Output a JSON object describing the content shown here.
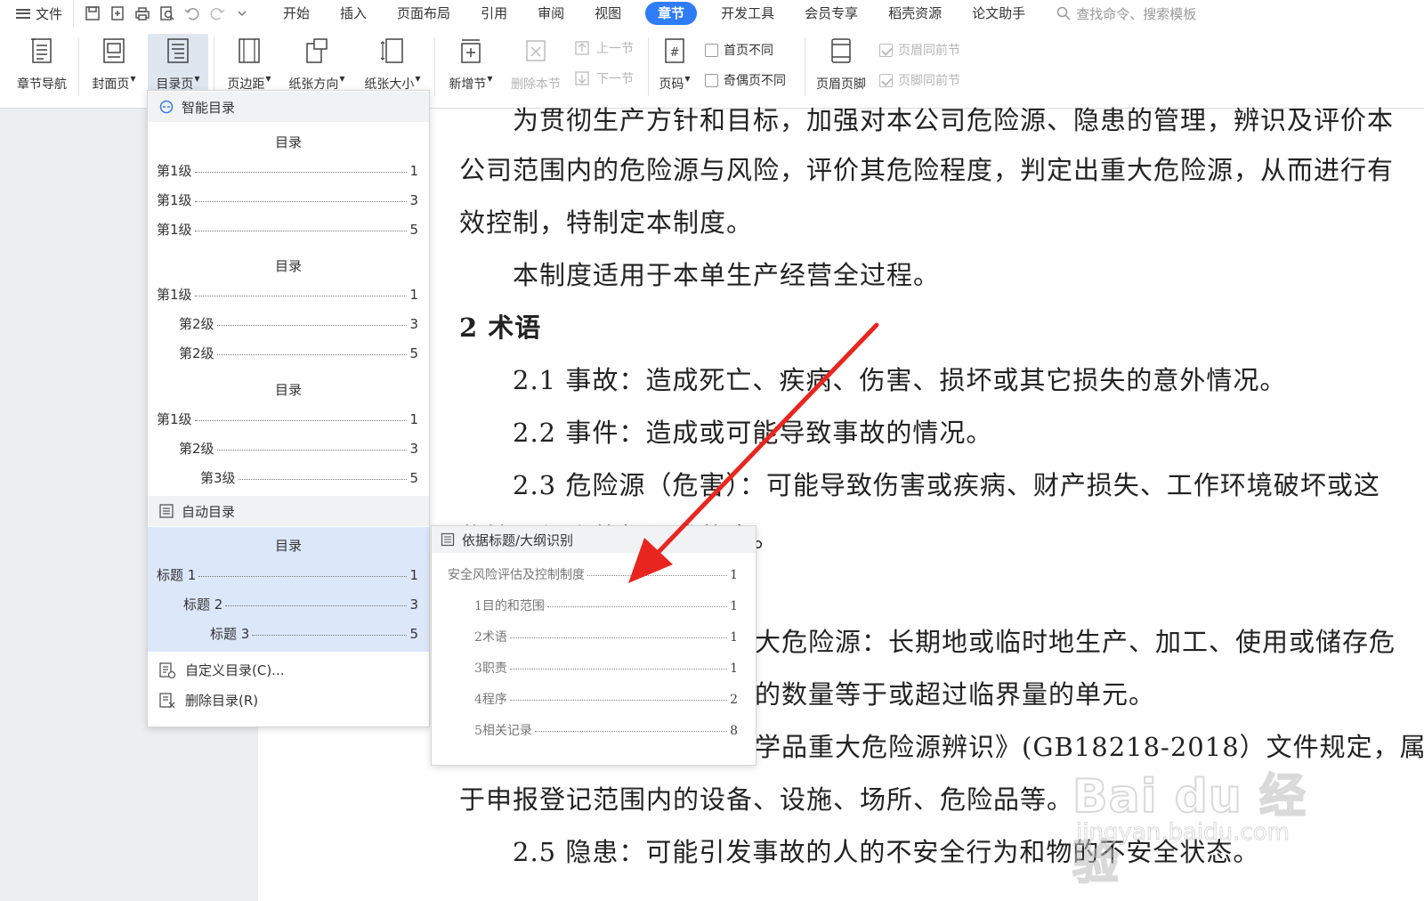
{
  "menubar": {
    "file_label": "文件",
    "tabs": [
      "开始",
      "插入",
      "页面布局",
      "引用",
      "审阅",
      "视图",
      "章节",
      "开发工具",
      "会员专享",
      "稻壳资源",
      "论文助手"
    ],
    "active_tab": "章节",
    "search_placeholder": "查找命令、搜索模板"
  },
  "ribbon": {
    "chapter_nav": "章节导航",
    "cover": "封面页",
    "toc": "目录页",
    "margins": "页边距",
    "orientation": "纸张方向",
    "paper_size": "纸张大小",
    "new_section": "新增节",
    "delete_section": "删除本节",
    "prev_section": "上一节",
    "next_section": "下一节",
    "page_number": "页码",
    "first_page_diff": "首页不同",
    "odd_even_diff": "奇偶页不同",
    "header_footer": "页眉页脚",
    "header_same_prev": "页眉同前节",
    "footer_same_prev": "页脚同前节"
  },
  "toc_menu": {
    "smart_toc_header": "智能目录",
    "toc_title": "目录",
    "style1": [
      {
        "label": "第1级",
        "page": "1"
      },
      {
        "label": "第1级",
        "page": "3"
      },
      {
        "label": "第1级",
        "page": "5"
      }
    ],
    "style2": [
      {
        "label": "第1级",
        "page": "1"
      },
      {
        "label": "第2级",
        "page": "3"
      },
      {
        "label": "第2级",
        "page": "5"
      }
    ],
    "style3": [
      {
        "label": "第1级",
        "page": "1"
      },
      {
        "label": "第2级",
        "page": "3"
      },
      {
        "label": "第3级",
        "page": "5"
      }
    ],
    "auto_toc_header": "自动目录",
    "auto_toc": [
      {
        "label": "标题 1",
        "page": "1"
      },
      {
        "label": "标题 2",
        "page": "3"
      },
      {
        "label": "标题 3",
        "page": "5"
      }
    ],
    "custom_toc": "自定义目录(C)...",
    "delete_toc": "删除目录(R)"
  },
  "submenu": {
    "header": "依据标题/大纲识别",
    "entries": [
      {
        "label": "安全风险评估及控制制度",
        "page": "1"
      },
      {
        "label": "1目的和范围",
        "page": "1"
      },
      {
        "label": "2术语",
        "page": "1"
      },
      {
        "label": "3职责",
        "page": "1"
      },
      {
        "label": "4程序",
        "page": "2"
      },
      {
        "label": "5相关记录",
        "page": "8"
      }
    ]
  },
  "document": {
    "lines": [
      "为贯彻生产方针和目标，加强对本公司危险源、隐患的管理，辨识及评价本",
      "公司范围内的危险源与风险，评价其危险程度，判定出重大危险源，从而进行有",
      "效控制，特制定本制度。",
      "本制度适用于本单生产经营全过程。",
      "2 术语",
      "2.1 事故：造成死亡、疾病、伤害、损坏或其它损失的意外情况。",
      "2.2 事件：造成或可能导致事故的情况。",
      "2.3 危险源（危害）：可能导致伤害或疾病、财产损失、工作环境破坏或这",
      "些情况组合的根源或状态。",
      "大危险源：长期地或临时地生产、加工、使用或储存危",
      "的数量等于或超过临界量的单元。",
      "学品重大危险源辨识》(GB18218-2018）文件规定，属",
      "于申报登记范围内的设备、设施、场所、危险品等。",
      "2.5 隐患：可能引发事故的人的不安全行为和物的不安全状态。"
    ]
  },
  "watermark": {
    "brand": "Bai du 经验",
    "url": "jingyan.baidu.com"
  },
  "colors": {
    "accent": "#2e7cf6",
    "arrow": "#e8261f",
    "highlight": "#dce7f9"
  }
}
